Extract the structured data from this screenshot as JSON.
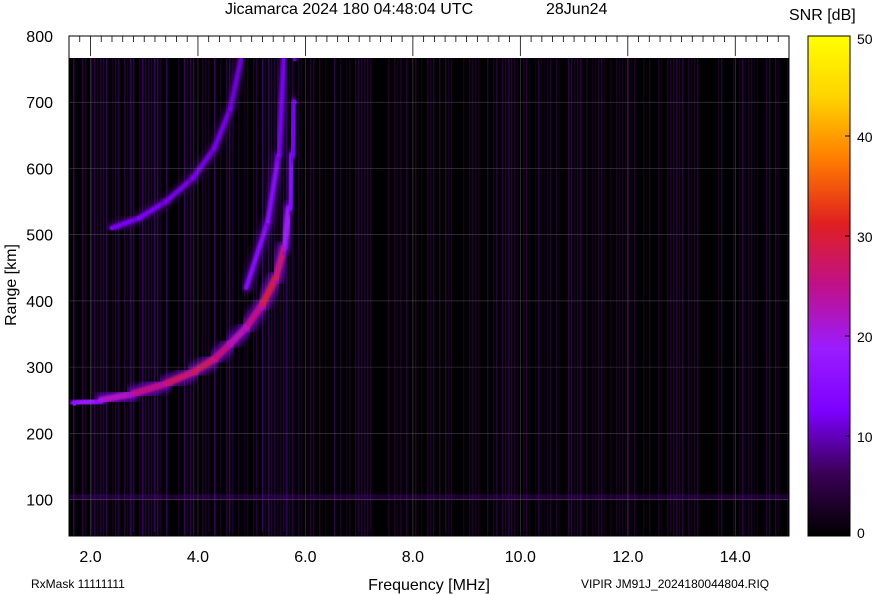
{
  "header": {
    "title": "Jicamarca 2024 180 04:48:04 UTC",
    "date": "28Jun24"
  },
  "footer": {
    "rx_mask": "RxMask 11111111",
    "file_info": "VIPIR  JM91J_2024180044804.RIQ"
  },
  "chart_data": {
    "type": "heatmap",
    "title": "Jicamarca 2024 180 04:48:04 UTC",
    "xlabel": "Frequency [MHz]",
    "ylabel": "Range [km]",
    "xlim": [
      1.6,
      15.0
    ],
    "ylim": [
      45,
      800
    ],
    "x_ticks": [
      "2.0",
      "4.0",
      "6.0",
      "8.0",
      "10.0",
      "12.0",
      "14.0"
    ],
    "x_tick_values": [
      2,
      4,
      6,
      8,
      10,
      12,
      14
    ],
    "y_ticks": [
      "100",
      "200",
      "300",
      "400",
      "500",
      "600",
      "700",
      "800"
    ],
    "y_tick_values": [
      100,
      200,
      300,
      400,
      500,
      600,
      700,
      800
    ],
    "grid": true,
    "colorbar": {
      "label": "SNR [dB]",
      "range": [
        0,
        50
      ],
      "ticks": [
        "0",
        "10",
        "20",
        "30",
        "40",
        "50"
      ],
      "tick_values": [
        0,
        10,
        20,
        30,
        40,
        50
      ],
      "colors": [
        "#000000",
        "#3a0055",
        "#7d00ff",
        "#9a1cff",
        "#c0108a",
        "#e02020",
        "#ff7a00",
        "#ffd200",
        "#ffff00"
      ]
    },
    "traces": [
      {
        "name": "",
        "trace": "o-mode",
        "points": [
          {
            "f": 1.7,
            "r": 245,
            "snr": 16
          },
          {
            "f": 2.2,
            "r": 250,
            "snr": 20
          },
          {
            "f": 2.8,
            "r": 260,
            "snr": 24
          },
          {
            "f": 3.4,
            "r": 275,
            "snr": 26
          },
          {
            "f": 3.9,
            "r": 292,
            "snr": 28
          },
          {
            "f": 4.3,
            "r": 312,
            "snr": 27
          },
          {
            "f": 4.6,
            "r": 335,
            "snr": 24
          },
          {
            "f": 4.9,
            "r": 360,
            "snr": 22
          },
          {
            "f": 5.2,
            "r": 395,
            "snr": 28
          },
          {
            "f": 5.45,
            "r": 435,
            "snr": 30
          },
          {
            "f": 5.6,
            "r": 480,
            "snr": 22
          },
          {
            "f": 5.7,
            "r": 540,
            "snr": 16
          },
          {
            "f": 5.75,
            "r": 620,
            "snr": 13
          },
          {
            "f": 5.8,
            "r": 700,
            "snr": 12
          },
          {
            "f": 5.8,
            "r": 765,
            "snr": 10
          }
        ]
      },
      {
        "name": "",
        "trace": "multi-hop echo",
        "points": [
          {
            "f": 2.4,
            "r": 510,
            "snr": 13
          },
          {
            "f": 2.9,
            "r": 525,
            "snr": 13
          },
          {
            "f": 3.4,
            "r": 550,
            "snr": 12
          },
          {
            "f": 3.9,
            "r": 585,
            "snr": 12
          },
          {
            "f": 4.3,
            "r": 630,
            "snr": 12
          },
          {
            "f": 4.6,
            "r": 690,
            "snr": 12
          },
          {
            "f": 4.8,
            "r": 765,
            "snr": 11
          }
        ]
      },
      {
        "name": "",
        "trace": "x-mode",
        "points": [
          {
            "f": 4.9,
            "r": 420,
            "snr": 14
          },
          {
            "f": 5.3,
            "r": 520,
            "snr": 16
          },
          {
            "f": 5.5,
            "r": 620,
            "snr": 14
          },
          {
            "f": 5.6,
            "r": 765,
            "snr": 12
          }
        ]
      }
    ]
  }
}
